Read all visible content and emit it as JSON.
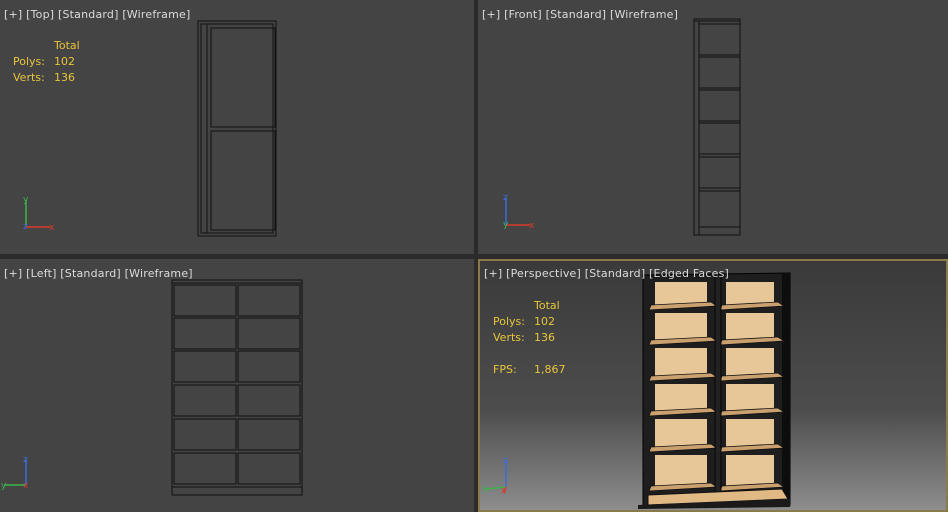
{
  "viewports": {
    "top": {
      "label": [
        "[+]",
        "[Top]",
        "[Standard]",
        "[Wireframe]"
      ],
      "stats": {
        "header": "Total",
        "polys_label": "Polys:",
        "polys": "102",
        "verts_label": "Verts:",
        "verts": "136"
      }
    },
    "front": {
      "label": [
        "[+]",
        "[Front]",
        "[Standard]",
        "[Wireframe]"
      ]
    },
    "left": {
      "label": [
        "[+]",
        "[Left]",
        "[Standard]",
        "[Wireframe]"
      ]
    },
    "persp": {
      "label": [
        "[+]",
        "[Perspective]",
        "[Standard]",
        "[Edged Faces]"
      ],
      "stats": {
        "header": "Total",
        "polys_label": "Polys:",
        "polys": "102",
        "verts_label": "Verts:",
        "verts": "136",
        "fps_label": "FPS:",
        "fps": "1,867"
      }
    }
  },
  "axes": {
    "x": "x",
    "y": "y",
    "z": "z"
  },
  "colors": {
    "axis_x": "#d93a2b",
    "axis_y": "#3bb54a",
    "axis_z": "#3a6bd9",
    "stats_text": "#e8c53a",
    "active_border": "#8a7a4a",
    "wood": "#e7c797"
  }
}
